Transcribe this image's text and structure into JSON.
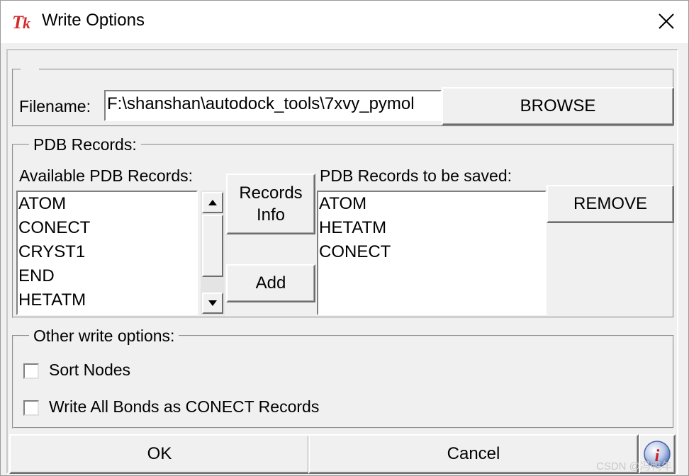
{
  "window": {
    "title": "Write Options",
    "icon": "tk-feather-icon",
    "close_icon": "close-icon"
  },
  "file": {
    "label": "Filename:",
    "value": "F:\\shanshan\\autodock_tools\\7xvy_pymol",
    "browse_label": "BROWSE"
  },
  "records": {
    "group_title": "PDB Records:",
    "available_label": "Available PDB Records:",
    "available_items": [
      "ATOM",
      "CONECT",
      "CRYST1",
      "END",
      "HETATM"
    ],
    "records_info_label": "Records\nInfo",
    "add_label": "Add",
    "saved_label": "PDB Records to be saved:",
    "saved_items": [
      "ATOM",
      "HETATM",
      "CONECT"
    ],
    "remove_label": "REMOVE"
  },
  "other": {
    "group_title": "Other write options:",
    "sort_nodes_label": "Sort Nodes",
    "sort_nodes_checked": false,
    "write_bonds_label": "Write All Bonds as CONECT Records",
    "write_bonds_checked": false
  },
  "footer": {
    "ok_label": "OK",
    "cancel_label": "Cancel",
    "info_icon": "info-icon"
  },
  "watermark": "CSDN @冯鸭年"
}
